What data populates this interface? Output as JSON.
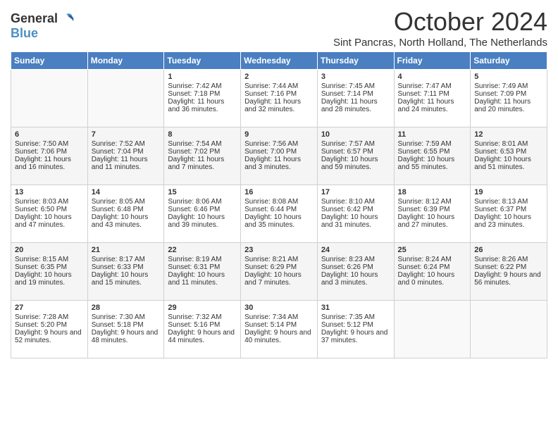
{
  "logo": {
    "line1": "General",
    "line2": "Blue"
  },
  "title": "October 2024",
  "location": "Sint Pancras, North Holland, The Netherlands",
  "days_of_week": [
    "Sunday",
    "Monday",
    "Tuesday",
    "Wednesday",
    "Thursday",
    "Friday",
    "Saturday"
  ],
  "weeks": [
    [
      {
        "day": "",
        "sunrise": "",
        "sunset": "",
        "daylight": ""
      },
      {
        "day": "",
        "sunrise": "",
        "sunset": "",
        "daylight": ""
      },
      {
        "day": "1",
        "sunrise": "Sunrise: 7:42 AM",
        "sunset": "Sunset: 7:18 PM",
        "daylight": "Daylight: 11 hours and 36 minutes."
      },
      {
        "day": "2",
        "sunrise": "Sunrise: 7:44 AM",
        "sunset": "Sunset: 7:16 PM",
        "daylight": "Daylight: 11 hours and 32 minutes."
      },
      {
        "day": "3",
        "sunrise": "Sunrise: 7:45 AM",
        "sunset": "Sunset: 7:14 PM",
        "daylight": "Daylight: 11 hours and 28 minutes."
      },
      {
        "day": "4",
        "sunrise": "Sunrise: 7:47 AM",
        "sunset": "Sunset: 7:11 PM",
        "daylight": "Daylight: 11 hours and 24 minutes."
      },
      {
        "day": "5",
        "sunrise": "Sunrise: 7:49 AM",
        "sunset": "Sunset: 7:09 PM",
        "daylight": "Daylight: 11 hours and 20 minutes."
      }
    ],
    [
      {
        "day": "6",
        "sunrise": "Sunrise: 7:50 AM",
        "sunset": "Sunset: 7:06 PM",
        "daylight": "Daylight: 11 hours and 16 minutes."
      },
      {
        "day": "7",
        "sunrise": "Sunrise: 7:52 AM",
        "sunset": "Sunset: 7:04 PM",
        "daylight": "Daylight: 11 hours and 11 minutes."
      },
      {
        "day": "8",
        "sunrise": "Sunrise: 7:54 AM",
        "sunset": "Sunset: 7:02 PM",
        "daylight": "Daylight: 11 hours and 7 minutes."
      },
      {
        "day": "9",
        "sunrise": "Sunrise: 7:56 AM",
        "sunset": "Sunset: 7:00 PM",
        "daylight": "Daylight: 11 hours and 3 minutes."
      },
      {
        "day": "10",
        "sunrise": "Sunrise: 7:57 AM",
        "sunset": "Sunset: 6:57 PM",
        "daylight": "Daylight: 10 hours and 59 minutes."
      },
      {
        "day": "11",
        "sunrise": "Sunrise: 7:59 AM",
        "sunset": "Sunset: 6:55 PM",
        "daylight": "Daylight: 10 hours and 55 minutes."
      },
      {
        "day": "12",
        "sunrise": "Sunrise: 8:01 AM",
        "sunset": "Sunset: 6:53 PM",
        "daylight": "Daylight: 10 hours and 51 minutes."
      }
    ],
    [
      {
        "day": "13",
        "sunrise": "Sunrise: 8:03 AM",
        "sunset": "Sunset: 6:50 PM",
        "daylight": "Daylight: 10 hours and 47 minutes."
      },
      {
        "day": "14",
        "sunrise": "Sunrise: 8:05 AM",
        "sunset": "Sunset: 6:48 PM",
        "daylight": "Daylight: 10 hours and 43 minutes."
      },
      {
        "day": "15",
        "sunrise": "Sunrise: 8:06 AM",
        "sunset": "Sunset: 6:46 PM",
        "daylight": "Daylight: 10 hours and 39 minutes."
      },
      {
        "day": "16",
        "sunrise": "Sunrise: 8:08 AM",
        "sunset": "Sunset: 6:44 PM",
        "daylight": "Daylight: 10 hours and 35 minutes."
      },
      {
        "day": "17",
        "sunrise": "Sunrise: 8:10 AM",
        "sunset": "Sunset: 6:42 PM",
        "daylight": "Daylight: 10 hours and 31 minutes."
      },
      {
        "day": "18",
        "sunrise": "Sunrise: 8:12 AM",
        "sunset": "Sunset: 6:39 PM",
        "daylight": "Daylight: 10 hours and 27 minutes."
      },
      {
        "day": "19",
        "sunrise": "Sunrise: 8:13 AM",
        "sunset": "Sunset: 6:37 PM",
        "daylight": "Daylight: 10 hours and 23 minutes."
      }
    ],
    [
      {
        "day": "20",
        "sunrise": "Sunrise: 8:15 AM",
        "sunset": "Sunset: 6:35 PM",
        "daylight": "Daylight: 10 hours and 19 minutes."
      },
      {
        "day": "21",
        "sunrise": "Sunrise: 8:17 AM",
        "sunset": "Sunset: 6:33 PM",
        "daylight": "Daylight: 10 hours and 15 minutes."
      },
      {
        "day": "22",
        "sunrise": "Sunrise: 8:19 AM",
        "sunset": "Sunset: 6:31 PM",
        "daylight": "Daylight: 10 hours and 11 minutes."
      },
      {
        "day": "23",
        "sunrise": "Sunrise: 8:21 AM",
        "sunset": "Sunset: 6:29 PM",
        "daylight": "Daylight: 10 hours and 7 minutes."
      },
      {
        "day": "24",
        "sunrise": "Sunrise: 8:23 AM",
        "sunset": "Sunset: 6:26 PM",
        "daylight": "Daylight: 10 hours and 3 minutes."
      },
      {
        "day": "25",
        "sunrise": "Sunrise: 8:24 AM",
        "sunset": "Sunset: 6:24 PM",
        "daylight": "Daylight: 10 hours and 0 minutes."
      },
      {
        "day": "26",
        "sunrise": "Sunrise: 8:26 AM",
        "sunset": "Sunset: 6:22 PM",
        "daylight": "Daylight: 9 hours and 56 minutes."
      }
    ],
    [
      {
        "day": "27",
        "sunrise": "Sunrise: 7:28 AM",
        "sunset": "Sunset: 5:20 PM",
        "daylight": "Daylight: 9 hours and 52 minutes."
      },
      {
        "day": "28",
        "sunrise": "Sunrise: 7:30 AM",
        "sunset": "Sunset: 5:18 PM",
        "daylight": "Daylight: 9 hours and 48 minutes."
      },
      {
        "day": "29",
        "sunrise": "Sunrise: 7:32 AM",
        "sunset": "Sunset: 5:16 PM",
        "daylight": "Daylight: 9 hours and 44 minutes."
      },
      {
        "day": "30",
        "sunrise": "Sunrise: 7:34 AM",
        "sunset": "Sunset: 5:14 PM",
        "daylight": "Daylight: 9 hours and 40 minutes."
      },
      {
        "day": "31",
        "sunrise": "Sunrise: 7:35 AM",
        "sunset": "Sunset: 5:12 PM",
        "daylight": "Daylight: 9 hours and 37 minutes."
      },
      {
        "day": "",
        "sunrise": "",
        "sunset": "",
        "daylight": ""
      },
      {
        "day": "",
        "sunrise": "",
        "sunset": "",
        "daylight": ""
      }
    ]
  ]
}
